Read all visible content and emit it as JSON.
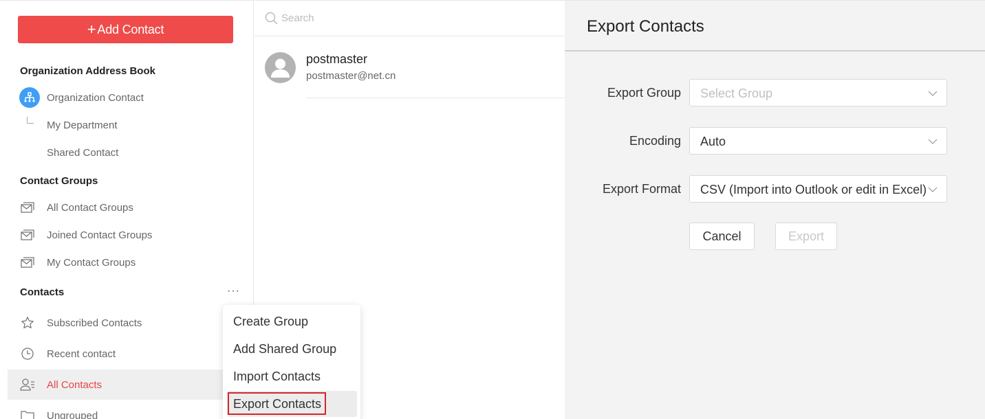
{
  "sidebar": {
    "add_contact_label": "Add Contact",
    "org_section": "Organization Address Book",
    "org_items": [
      "Organization Contact",
      "My Department",
      "Shared Contact"
    ],
    "groups_section": "Contact Groups",
    "group_items": [
      "All Contact Groups",
      "Joined Contact Groups",
      "My Contact Groups"
    ],
    "contacts_section": "Contacts",
    "more_label": "···",
    "contact_items": [
      "Subscribed Contacts",
      "Recent contact",
      "All Contacts",
      "Ungrouped"
    ]
  },
  "search": {
    "placeholder": "Search"
  },
  "contact_list": [
    {
      "name": "postmaster",
      "email": "postmaster@net.cn"
    }
  ],
  "export_panel": {
    "title": "Export Contacts",
    "group_label": "Export Group",
    "group_placeholder": "Select Group",
    "encoding_label": "Encoding",
    "encoding_value": "Auto",
    "format_label": "Export Format",
    "format_value": "CSV (Import into Outlook or edit in Excel)",
    "cancel_label": "Cancel",
    "export_label": "Export"
  },
  "menu": {
    "items": [
      "Create Group",
      "Add Shared Group",
      "Import Contacts",
      "Export Contacts"
    ]
  },
  "colors": {
    "accent": "#ef4b4b",
    "active_text": "#e84343",
    "org_icon": "#3f9ef5"
  }
}
